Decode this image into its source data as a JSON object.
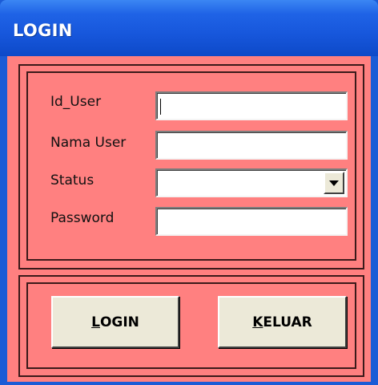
{
  "window": {
    "title": "LOGIN",
    "bg_color": "#ff8080",
    "title_color": "#1f63e6"
  },
  "form": {
    "id_user_label": "Id_User",
    "id_user_value": "",
    "nama_user_label": "Nama User",
    "nama_user_value": "",
    "status_label": "Status",
    "status_value": "",
    "password_label": "Password",
    "password_value": ""
  },
  "buttons": {
    "login": {
      "access_key": "L",
      "rest": "OGIN"
    },
    "keluar": {
      "access_key": "K",
      "rest": "ELUAR"
    }
  },
  "icons": {
    "dropdown": "chevron-down-icon"
  }
}
